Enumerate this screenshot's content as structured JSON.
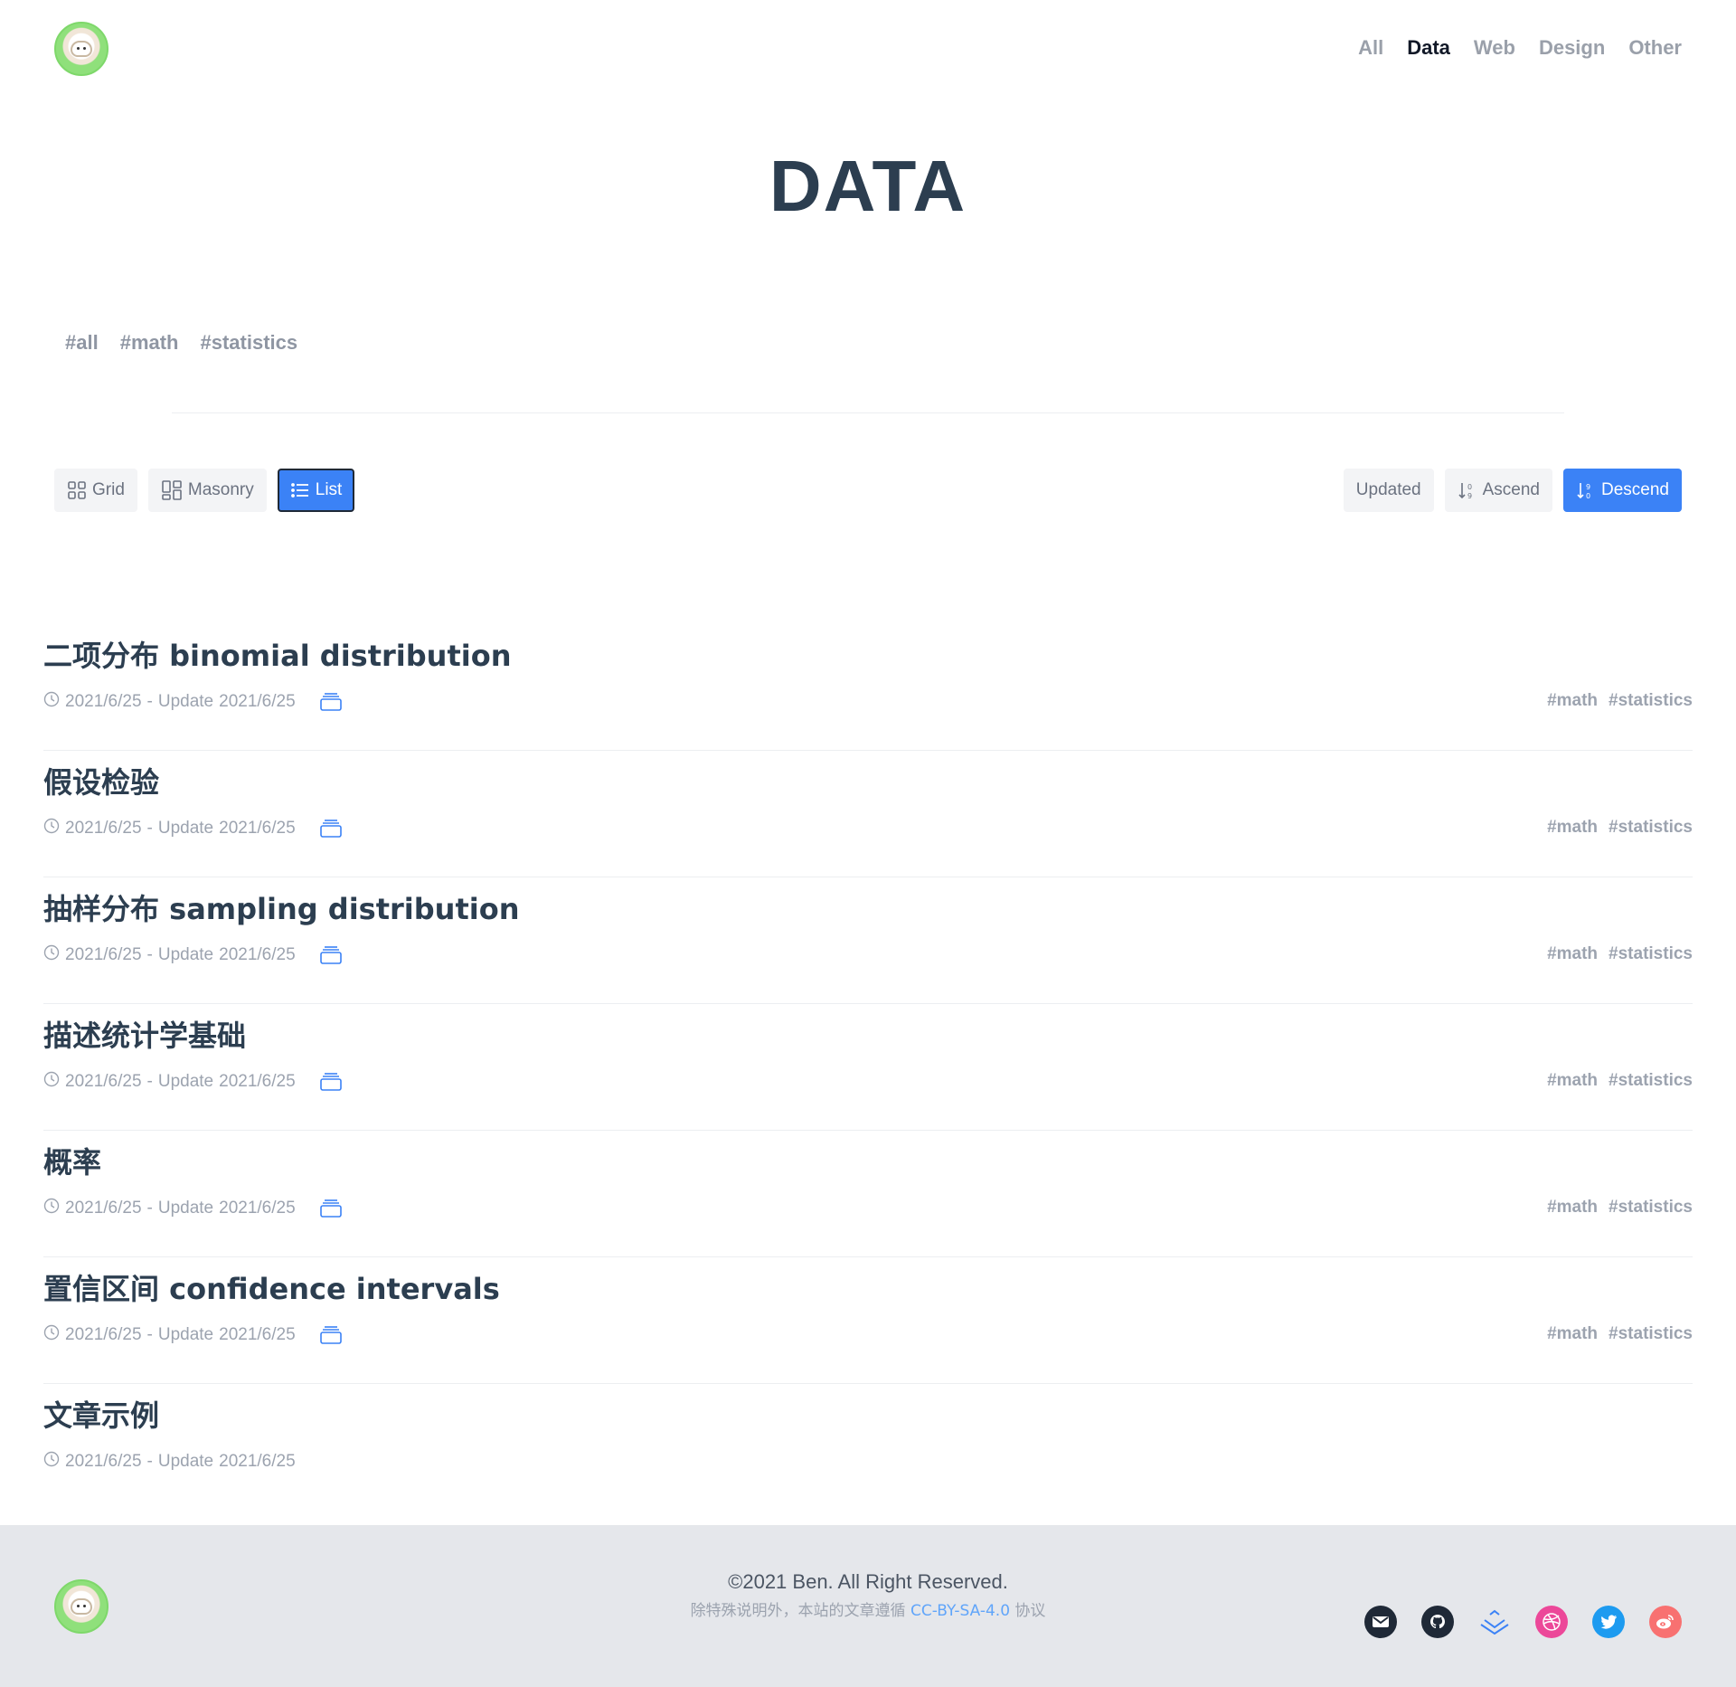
{
  "nav": {
    "items": [
      {
        "label": "All",
        "active": false
      },
      {
        "label": "Data",
        "active": true
      },
      {
        "label": "Web",
        "active": false
      },
      {
        "label": "Design",
        "active": false
      },
      {
        "label": "Other",
        "active": false
      }
    ]
  },
  "page_title": "DATA",
  "tag_filter": [
    "#all",
    "#math",
    "#statistics"
  ],
  "view_modes": {
    "grid": "Grid",
    "masonry": "Masonry",
    "list": "List",
    "selected": "List"
  },
  "sort": {
    "updated": "Updated",
    "ascend": "Ascend",
    "descend": "Descend",
    "selected": "Descend"
  },
  "posts": [
    {
      "title": "二项分布 binomial distribution",
      "date": "2021/6/25",
      "separator": "-",
      "update_label": "Update",
      "updated": "2021/6/25",
      "has_category": true,
      "tags": [
        "#math",
        "#statistics"
      ]
    },
    {
      "title": "假设检验",
      "date": "2021/6/25",
      "separator": "-",
      "update_label": "Update",
      "updated": "2021/6/25",
      "has_category": true,
      "tags": [
        "#math",
        "#statistics"
      ]
    },
    {
      "title": "抽样分布 sampling distribution",
      "date": "2021/6/25",
      "separator": "-",
      "update_label": "Update",
      "updated": "2021/6/25",
      "has_category": true,
      "tags": [
        "#math",
        "#statistics"
      ]
    },
    {
      "title": "描述统计学基础",
      "date": "2021/6/25",
      "separator": "-",
      "update_label": "Update",
      "updated": "2021/6/25",
      "has_category": true,
      "tags": [
        "#math",
        "#statistics"
      ]
    },
    {
      "title": "概率",
      "date": "2021/6/25",
      "separator": "-",
      "update_label": "Update",
      "updated": "2021/6/25",
      "has_category": true,
      "tags": [
        "#math",
        "#statistics"
      ]
    },
    {
      "title": "置信区间 confidence intervals",
      "date": "2021/6/25",
      "separator": "-",
      "update_label": "Update",
      "updated": "2021/6/25",
      "has_category": true,
      "tags": [
        "#math",
        "#statistics"
      ]
    },
    {
      "title": "文章示例",
      "date": "2021/6/25",
      "separator": "-",
      "update_label": "Update",
      "updated": "2021/6/25",
      "has_category": false,
      "tags": []
    }
  ],
  "footer": {
    "copyright": "©2021 Ben. All Right Reserved.",
    "license_prefix": "除特殊说明外，本站的文章遵循 ",
    "license_link": "CC-BY-SA-4.0",
    "license_suffix": " 协议",
    "socials": [
      {
        "icon": "email-icon",
        "color": "#1f2937"
      },
      {
        "icon": "github-icon",
        "color": "#1f2937"
      },
      {
        "icon": "juejin-icon",
        "color": "#3b82f6"
      },
      {
        "icon": "dribbble-icon",
        "color": "#ec4899"
      },
      {
        "icon": "twitter-icon",
        "color": "#1d9bf0"
      },
      {
        "icon": "weibo-icon",
        "color": "#f87171"
      }
    ]
  },
  "colors": {
    "accent": "#3b82f6",
    "title": "#2c3e50",
    "muted": "#9ca3af",
    "footer_bg": "#e5e7eb"
  }
}
